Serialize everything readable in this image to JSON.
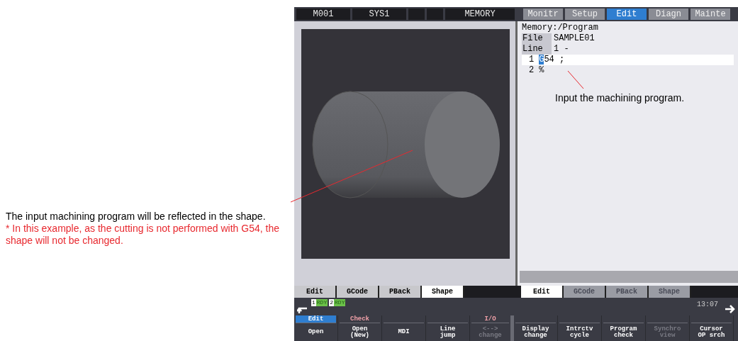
{
  "annotations": {
    "left": [
      {
        "kind": "note",
        "text": "The input machining program will be reflected in the shape."
      },
      {
        "kind": "warning",
        "text": "* In this example, as the cutting is not performed with G54, the shape will not be changed."
      }
    ],
    "right": {
      "kind": "note",
      "text": "Input the machining program."
    }
  },
  "top_bar": {
    "cells": [
      "M001",
      "SYS1"
    ],
    "mode": "MEMORY"
  },
  "menu_tabs": [
    {
      "label": "Monitr",
      "selected": false
    },
    {
      "label": "Setup",
      "selected": false
    },
    {
      "label": "Edit",
      "selected": true
    },
    {
      "label": "Diagn",
      "selected": false
    },
    {
      "label": "Mainte",
      "selected": false
    }
  ],
  "program": {
    "path": "Memory:/Program",
    "file_label": "File",
    "file": "SAMPLE01",
    "line_label": "Line",
    "line": "1 -",
    "lines": [
      {
        "number": "1",
        "text": "G54 ;",
        "selected": true
      },
      {
        "number": "2",
        "text": "%",
        "selected": false
      }
    ]
  },
  "left_tabs": [
    {
      "label": "Edit",
      "selected": false
    },
    {
      "label": "GCode",
      "selected": false
    },
    {
      "label": "PBack",
      "selected": false
    },
    {
      "label": "Shape",
      "selected": true
    }
  ],
  "right_tabs": [
    {
      "label": "Edit",
      "selected": true
    },
    {
      "label": "GCode",
      "selected": false
    },
    {
      "label": "PBack",
      "selected": false
    },
    {
      "label": "Shape",
      "selected": false
    }
  ],
  "status": {
    "indicators": [
      {
        "number": "1",
        "text": "RDY"
      },
      {
        "number": "2",
        "text": "RDY"
      }
    ],
    "time": "13:07"
  },
  "softkeys": [
    {
      "group": {
        "text": "Edit",
        "selected": true
      },
      "lines": [
        "Open"
      ],
      "disabled": false
    },
    {
      "group": {
        "text": "Check",
        "selected": false
      },
      "lines": [
        "Open",
        "(New)"
      ],
      "disabled": false
    },
    {
      "lines": [
        "MDI"
      ],
      "disabled": false
    },
    {
      "lines": [
        "Line",
        "jump"
      ],
      "disabled": false
    },
    {
      "group": {
        "text": "I/O",
        "selected": false
      },
      "lines": [
        "<-->",
        "change"
      ],
      "disabled": true
    },
    {
      "lines": [
        "Display",
        "change"
      ],
      "disabled": false
    },
    {
      "lines": [
        "Intrctv",
        "cycle"
      ],
      "disabled": false
    },
    {
      "lines": [
        "Program",
        "check"
      ],
      "disabled": false
    },
    {
      "lines": [
        "Synchro",
        "view"
      ],
      "disabled": true
    },
    {
      "lines": [
        "Cursor",
        "OP srch"
      ],
      "disabled": false
    }
  ]
}
